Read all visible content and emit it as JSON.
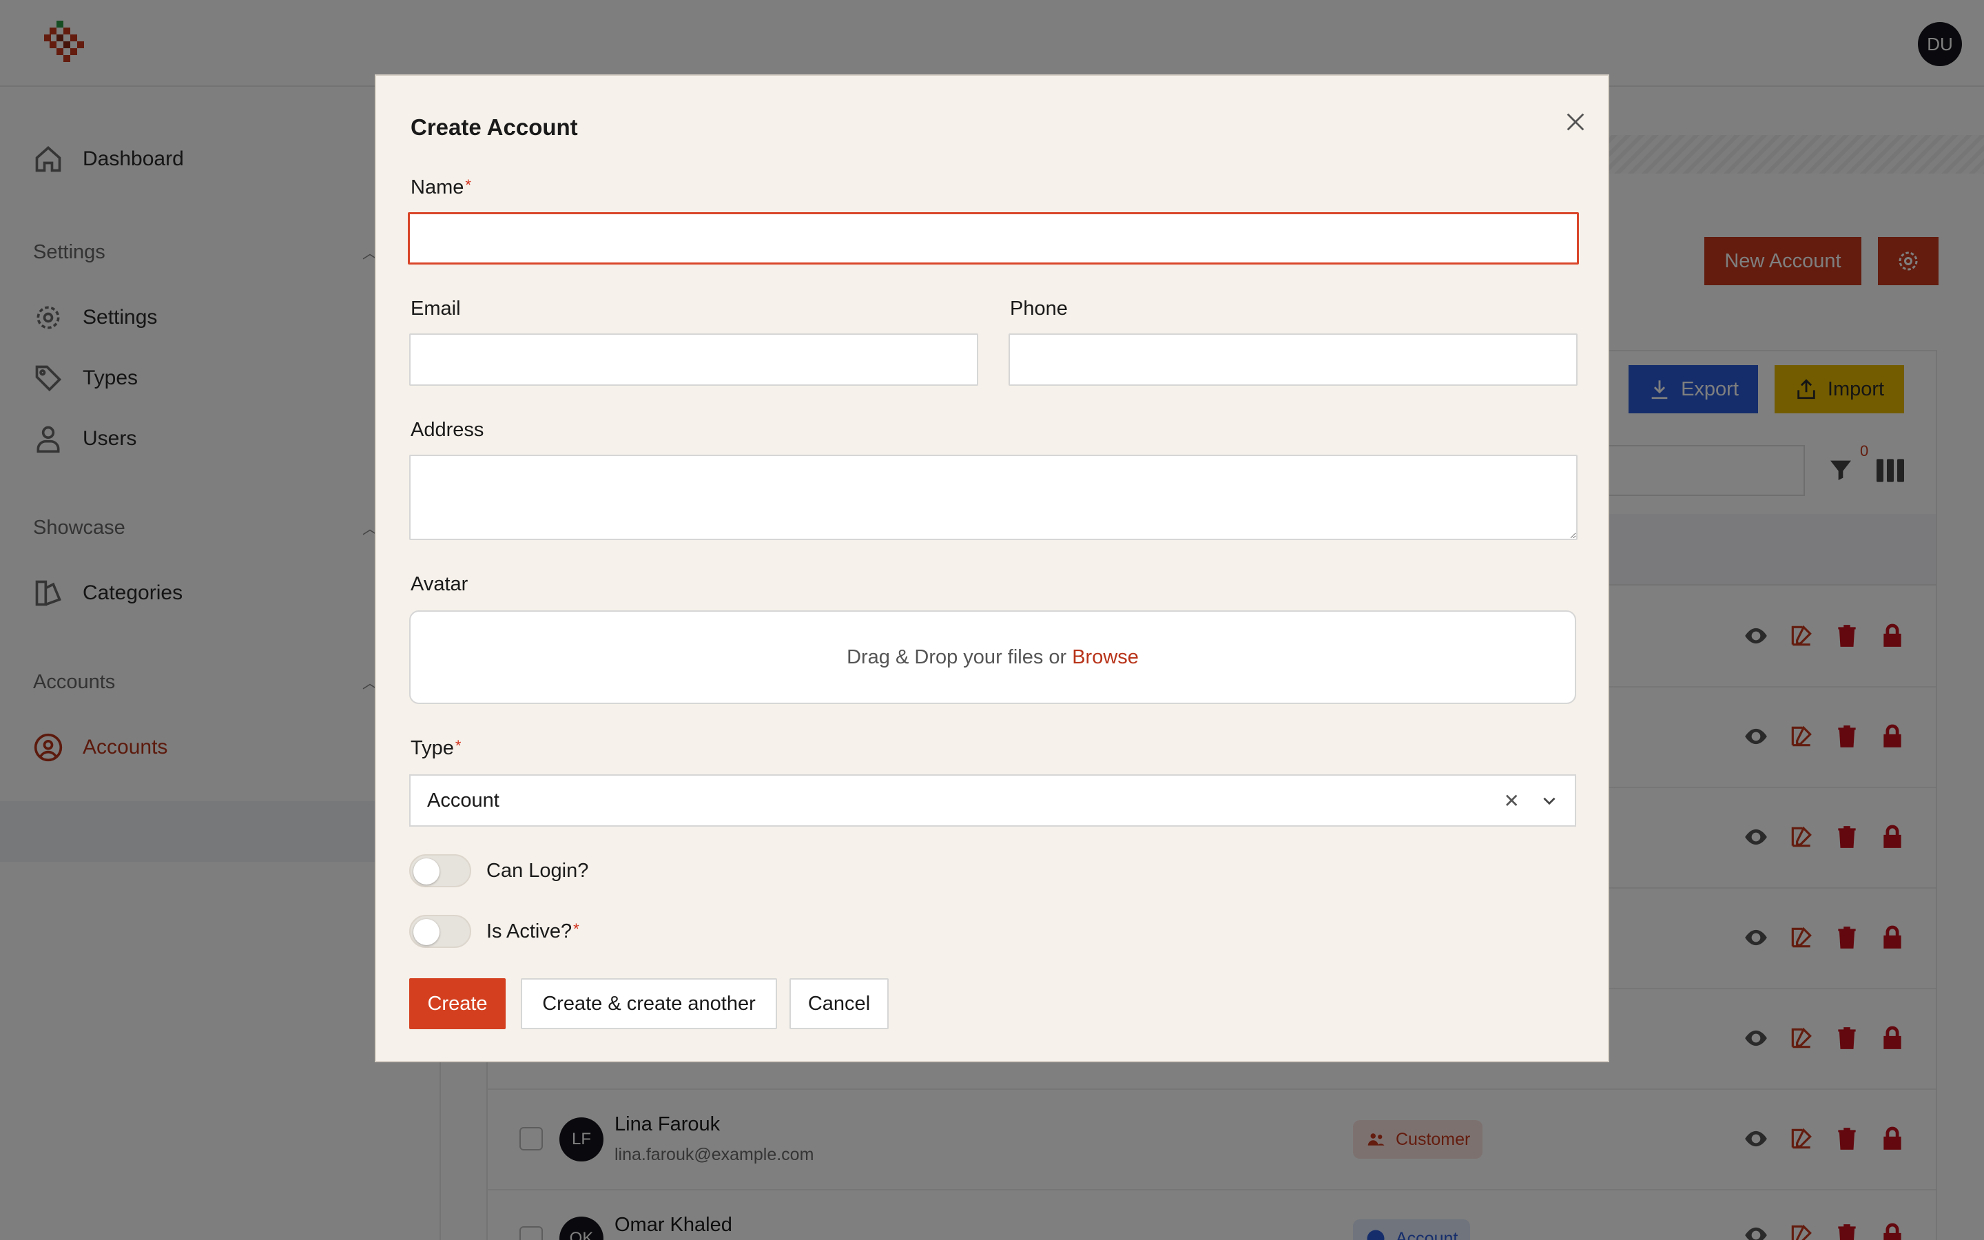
{
  "header": {
    "user_initials": "DU"
  },
  "sidebar": {
    "dashboard": "Dashboard",
    "groups": [
      {
        "label": "Settings",
        "items": [
          "Settings",
          "Types",
          "Users"
        ]
      },
      {
        "label": "Showcase",
        "items": [
          "Categories"
        ]
      },
      {
        "label": "Accounts",
        "items": [
          "Accounts"
        ]
      }
    ]
  },
  "page": {
    "new_account_label": "New Account",
    "export_label": "Export",
    "import_label": "Import",
    "filter_count": "0"
  },
  "table": {
    "rows": [
      {
        "initials": "LF",
        "name": "Lina Farouk",
        "email": "lina.farouk@example.com",
        "type": "Customer"
      },
      {
        "initials": "OK",
        "name": "Omar Khaled",
        "email": "",
        "type": "Account"
      }
    ]
  },
  "modal": {
    "title": "Create Account",
    "name_label": "Name",
    "name_value": "",
    "email_label": "Email",
    "email_value": "",
    "phone_label": "Phone",
    "phone_value": "",
    "address_label": "Address",
    "address_value": "",
    "avatar_label": "Avatar",
    "dropzone_text": "Drag & Drop your files or",
    "dropzone_browse": "Browse",
    "type_label": "Type",
    "type_value": "Account",
    "can_login_label": "Can Login?",
    "can_login_on": false,
    "is_active_label": "Is Active?",
    "is_active_on": false,
    "create_label": "Create",
    "create_another_label": "Create & create another",
    "cancel_label": "Cancel",
    "required_marker": "*"
  },
  "colors": {
    "primary": "#d4401f",
    "modal_bg": "#f6f1ea",
    "error_border": "#d9462a"
  }
}
